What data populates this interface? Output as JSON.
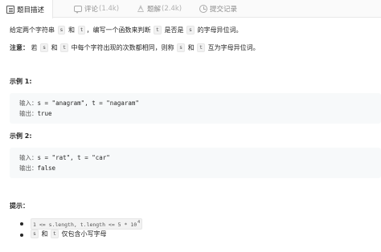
{
  "tabs": [
    {
      "label": "题目描述",
      "count": ""
    },
    {
      "label": "评论",
      "count": "(1.4k)"
    },
    {
      "label": "题解",
      "count": "(2.4k)"
    },
    {
      "label": "提交记录",
      "count": ""
    }
  ],
  "description": {
    "p1_before_s": "给定两个字符串",
    "p1_s": "s",
    "p1_and": "和",
    "p1_t": "t",
    "p1_mid": "，编写一个函数来判断",
    "p1_t2": "t",
    "p1_mid2": "是否是",
    "p1_s2": "s",
    "p1_end": "的字母异位词。",
    "note_label": "注意：",
    "note_if": "若",
    "note_s": "s",
    "note_and": "和",
    "note_t": "t",
    "note_mid": "中每个字符出现的次数都相同，则称",
    "note_s2": "s",
    "note_and2": "和",
    "note_t2": "t",
    "note_end": "互为字母异位词。"
  },
  "examples": [
    {
      "title": "示例 1:",
      "input_label": "输入：",
      "input": "s = \"anagram\", t = \"nagaram\"",
      "output_label": "输出：",
      "output": "true"
    },
    {
      "title": "示例 2:",
      "input_label": "输入：",
      "input": "s = \"rat\", t = \"car\"",
      "output_label": "输出：",
      "output": "false"
    }
  ],
  "hints": {
    "title": "提示：",
    "c1_code": "1 <= s.length, t.length <= 5 * 10",
    "c1_exp": "4",
    "c2_s": "s",
    "c2_and": "和",
    "c2_t": "t",
    "c2_rest": "仅包含小写字母"
  }
}
